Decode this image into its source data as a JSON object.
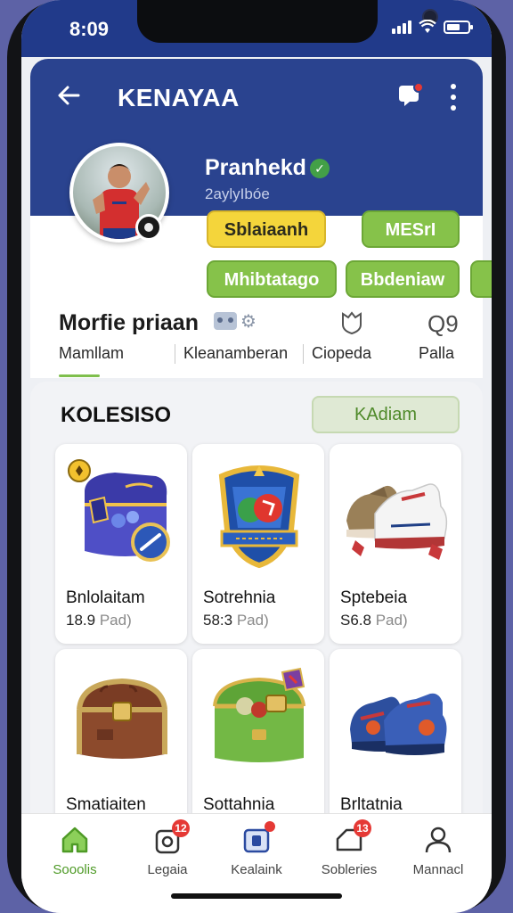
{
  "status_bar": {
    "time": "8:09"
  },
  "header": {
    "title": "KENAYAA"
  },
  "profile": {
    "name": "Pranhekd",
    "handle": "2aylyIbóe",
    "chips": [
      "Sblaiaanh",
      "MESrI",
      "Mhibtatago",
      "Bbdeniaw"
    ]
  },
  "stats": {
    "title": "Morfie priaan",
    "count": "Q9",
    "tabs": [
      "Mamllam",
      "Kleanamberan",
      "Ciopeda",
      "Palla"
    ]
  },
  "section": {
    "title": "KOLESISO",
    "action_label": "KAdiam",
    "items": [
      {
        "name": "Bnlolaitam",
        "price": "18.9",
        "unit": "Pad)"
      },
      {
        "name": "Sotrehnia",
        "price": "58:3",
        "unit": "Pad)"
      },
      {
        "name": "Sptebeia",
        "price": "S6.8",
        "unit": "Pad)"
      },
      {
        "name": "Smatiaiten",
        "price": "",
        "unit": ""
      },
      {
        "name": "Sottahnia",
        "price": "",
        "unit": ""
      },
      {
        "name": "Brltatnia",
        "price": "",
        "unit": ""
      }
    ]
  },
  "bottom_nav": [
    {
      "label": "Sooolis",
      "icon": "home-icon",
      "badge": ""
    },
    {
      "label": "Legaia",
      "icon": "bag-icon",
      "badge": "12"
    },
    {
      "label": "Kealaink",
      "icon": "folder-icon",
      "badge": ""
    },
    {
      "label": "Sobleries",
      "icon": "tag-icon",
      "badge": "13"
    },
    {
      "label": "Mannacl",
      "icon": "user-icon",
      "badge": ""
    }
  ],
  "colors": {
    "header_blue": "#2a438f",
    "accent_green": "#86c24a",
    "accent_yellow": "#f4d53b",
    "badge_red": "#e53935"
  }
}
